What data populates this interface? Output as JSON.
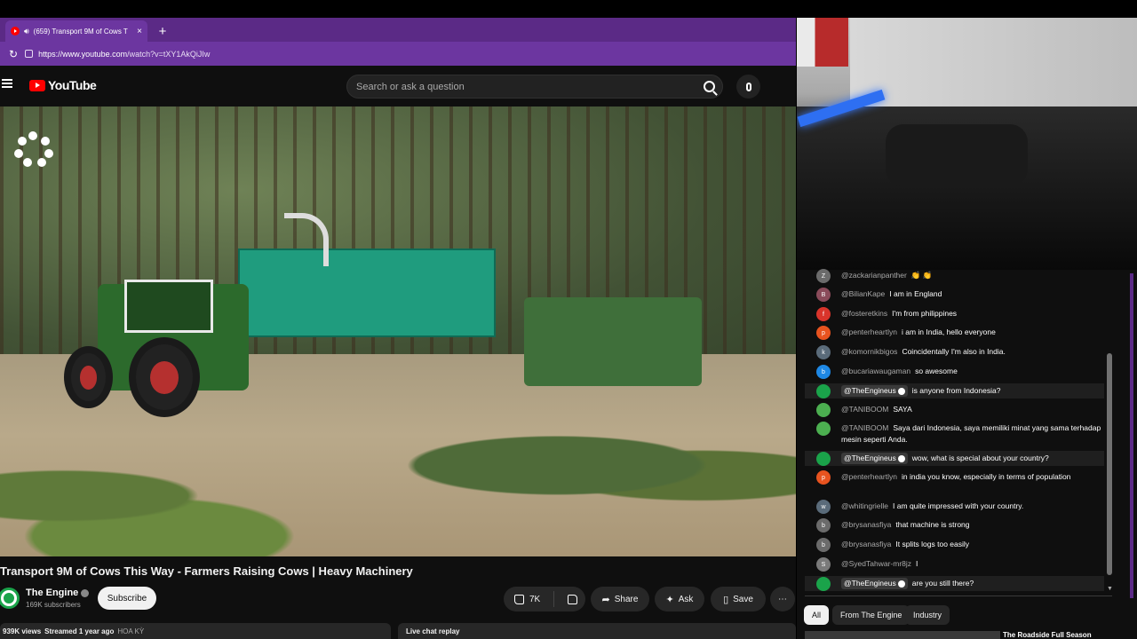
{
  "browser": {
    "tab_title": "(659) Transport 9M of Cows T",
    "tab_close": "×",
    "new_tab": "+",
    "url_host": "https://www.youtube.com",
    "url_path": "/watch?v=tXY1AkQiJIw"
  },
  "youtube": {
    "logo_text": "YouTube",
    "search_placeholder": "Search or ask a question"
  },
  "video": {
    "title": "Transport 9M of Cows This Way - Farmers Raising Cows | Heavy Machinery",
    "channel": "The Engine",
    "subscribers": "169K subscribers",
    "subscribe_label": "Subscribe",
    "likes": "7K",
    "share_label": "Share",
    "ask_label": "Ask",
    "save_label": "Save",
    "more_label": "⋯",
    "views": "939K views",
    "streamed": "Streamed 1 year ago",
    "location": "HOA KỲ",
    "chat_replay_label": "Live chat replay"
  },
  "chat": {
    "messages": [
      {
        "initial": "Z",
        "color": "#6b6b6b",
        "author": "@zackarianpanther",
        "text": "👏 👏",
        "owner": false
      },
      {
        "initial": "B",
        "color": "#8a4b5a",
        "author": "@BilianKape",
        "text": "I am in England",
        "owner": false
      },
      {
        "initial": "f",
        "color": "#d9342b",
        "author": "@fosteretkins",
        "text": "I'm from philippines",
        "owner": false
      },
      {
        "initial": "p",
        "color": "#e8531f",
        "author": "@penterheartlyn",
        "text": "i am in India, hello everyone",
        "owner": false
      },
      {
        "initial": "k",
        "color": "#5a6b7a",
        "author": "@komornikbigos",
        "text": "Coincidentally I'm also in India.",
        "owner": false
      },
      {
        "initial": "b",
        "color": "#1e88e5",
        "author": "@bucariawaugaman",
        "text": "so awesome",
        "owner": false
      },
      {
        "initial": "",
        "color": "#1aa34a",
        "author": "@TheEngineus",
        "text": "is anyone from Indonesia?",
        "owner": true
      },
      {
        "initial": "",
        "color": "#4caf50",
        "author": "@TANIBOOM",
        "text": "SAYA",
        "owner": false
      },
      {
        "initial": "",
        "color": "#4caf50",
        "author": "@TANIBOOM",
        "text": "Saya dari Indonesia, saya memiliki minat yang sama terhadap mesin seperti Anda.",
        "owner": false
      },
      {
        "initial": "",
        "color": "#1aa34a",
        "author": "@TheEngineus",
        "text": "wow, what is special about your country?",
        "owner": true
      },
      {
        "initial": "p",
        "color": "#e8531f",
        "author": "@penterheartlyn",
        "text": "in india you know, especially in terms of population",
        "owner": false
      },
      {
        "initial": "w",
        "color": "#5a6b7a",
        "author": "@whitingrielle",
        "text": "I am quite impressed with your country.",
        "owner": false
      },
      {
        "initial": "b",
        "color": "#6b6b6b",
        "author": "@brysanasfiya",
        "text": "that machine is strong",
        "owner": false
      },
      {
        "initial": "b",
        "color": "#6b6b6b",
        "author": "@brysanasfiya",
        "text": "It splits logs too easily",
        "owner": false
      },
      {
        "initial": "S",
        "color": "#7a7a7a",
        "author": "@SyedTahwar-mr8jz",
        "text": "I",
        "owner": false
      },
      {
        "initial": "",
        "color": "#1aa34a",
        "author": "@TheEngineus",
        "text": "are you still there?",
        "owner": true
      }
    ],
    "chips": [
      "All",
      "From The Engine",
      "Industry"
    ],
    "recommendation_title": "The Roadside Full Season"
  },
  "colors": {
    "browser_accent": "#6c36a0",
    "youtube_red": "#ff0000",
    "owner_green": "#1aa34a"
  }
}
